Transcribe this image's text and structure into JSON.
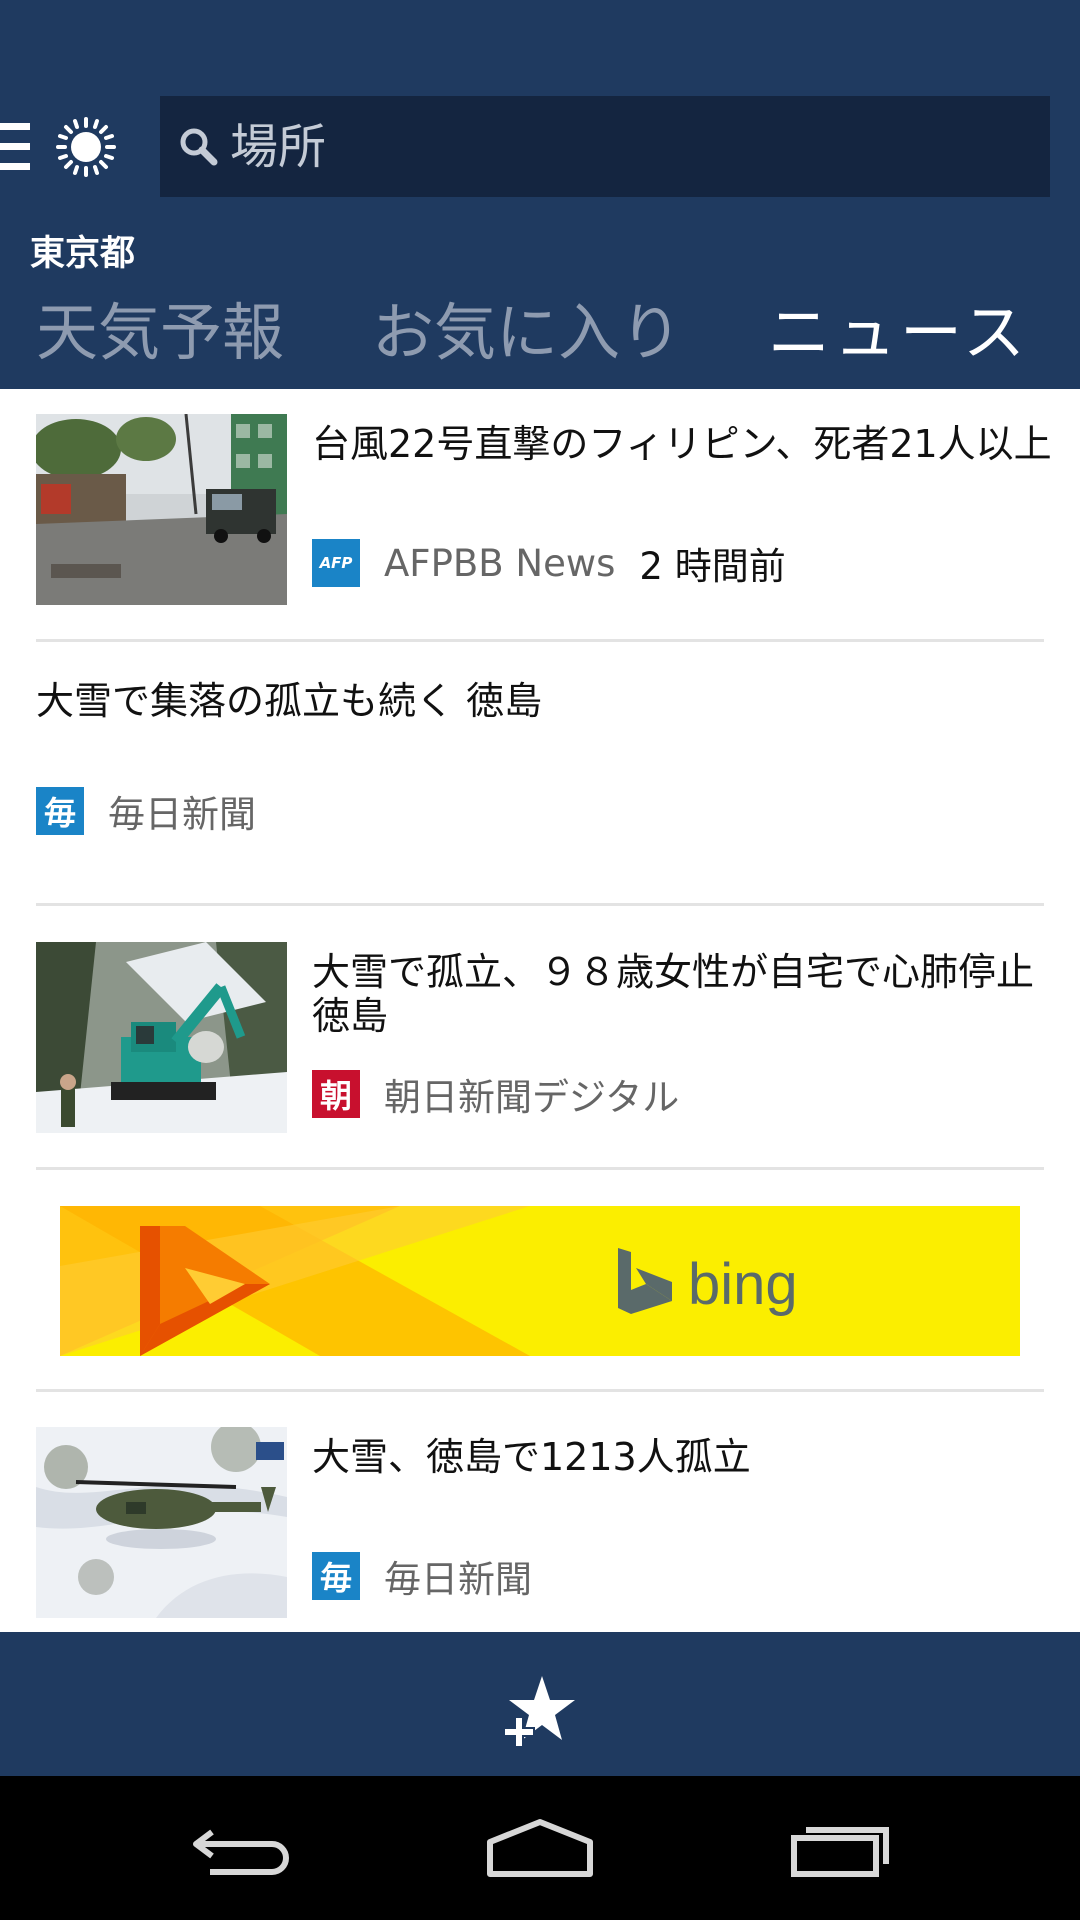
{
  "header": {
    "search_placeholder": "場所",
    "location": "東京都",
    "tabs": [
      {
        "label": "天気予報",
        "active": false
      },
      {
        "label": "お気に入り",
        "active": false
      },
      {
        "label": "ニュース",
        "active": true
      }
    ]
  },
  "news": [
    {
      "title": "台風22号直撃のフィリピン、死者21人以上",
      "source": "AFPBB News",
      "source_logo_text": "AFP",
      "source_logo_color": "#1a84c7",
      "time": "2 時間前",
      "image": "typhoon-street-photo"
    },
    {
      "title": "大雪で集落の孤立も続く 徳島",
      "source": "毎日新聞",
      "source_logo_text": "毎",
      "source_logo_color": "#1a84c7"
    },
    {
      "title": "大雪で孤立、９８歳女性が自宅で心肺停止 徳島",
      "source": "朝日新聞デジタル",
      "source_logo_text": "朝",
      "source_logo_color": "#c8102e",
      "image": "excavator-snow-photo"
    },
    {
      "title": "大雪、徳島で1213人孤立",
      "source": "毎日新聞",
      "source_logo_text": "毎",
      "source_logo_color": "#1a84c7",
      "image": "helicopter-snow-photo"
    }
  ],
  "ad": {
    "brand": "bing",
    "background_color": "#fbee00"
  },
  "colors": {
    "header_bg": "#1f3a60",
    "search_bg": "#142540",
    "tab_inactive": "#8e9bb0"
  },
  "icons": {
    "menu": "hamburger-icon",
    "weather": "sun-icon",
    "search": "search-icon",
    "favorite_add": "star-plus-icon",
    "nav_back": "back-arrow-icon",
    "nav_home": "home-icon",
    "nav_recent": "recent-apps-icon"
  }
}
